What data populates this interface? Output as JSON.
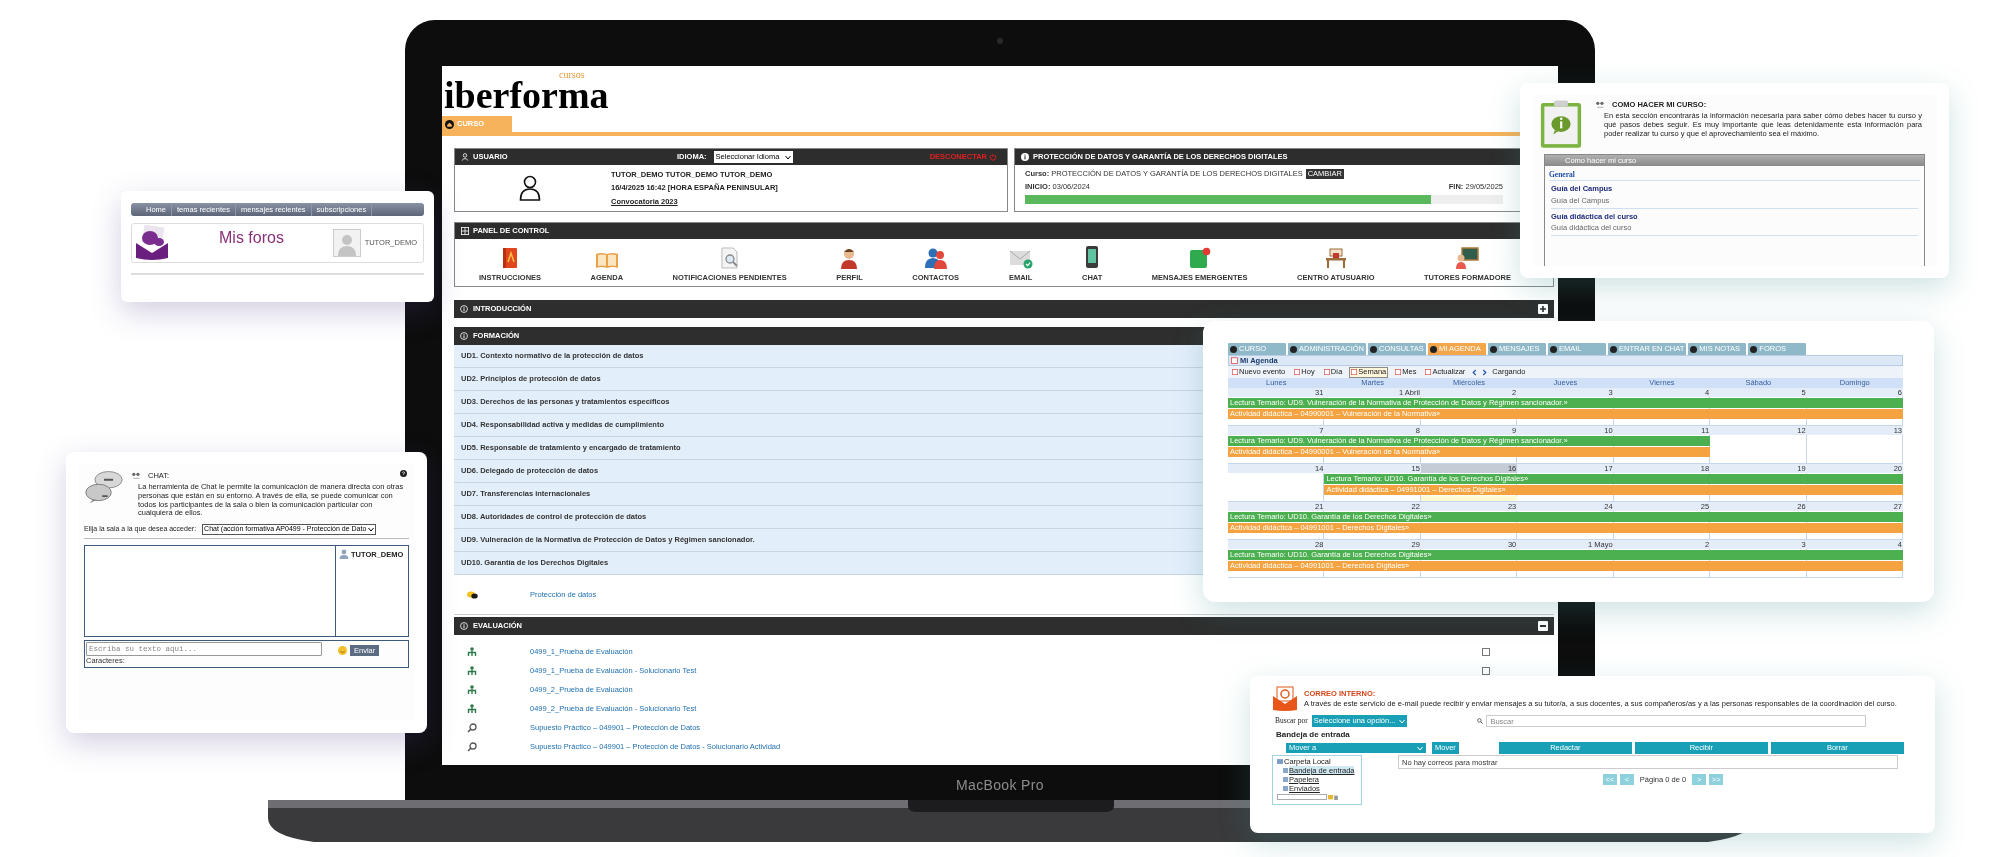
{
  "laptop": {
    "label": "MacBook Pro"
  },
  "screen": {
    "logo": {
      "small": "cursos",
      "main": "iberforma"
    },
    "tabs": [
      {
        "label": "CURSO",
        "selected": true
      }
    ],
    "user_panel": {
      "title": "USUARIO",
      "language_label": "IDIOMA:",
      "language_select": "Seleccionar Idioma",
      "logout": "DESCONECTAR",
      "name": "TUTOR_DEMO TUTOR_DEMO TUTOR_DEMO",
      "datetime": "16/4/2025 16:42 [HORA ESPAÑA PENINSULAR]",
      "link": "Convocatoria 2023"
    },
    "course_panel": {
      "title": "PROTECCIÓN DE DATOS Y GARANTÍA DE LOS DERECHOS DIGITALES",
      "course": "**Curso:** PROTECCIÓN DE DATOS Y GARANTÍA DE LOS DERECHOS DIGITALES",
      "change_button": "CAMBIAR",
      "start": "**INICIO:** 03/06/2024",
      "end": "**FIN:** 29/05/2025",
      "level": 0.85
    },
    "control_panel": {
      "title": "PANEL DE CONTROL",
      "items": [
        "INSTRUCCIONES",
        "AGENDA",
        "NOTIFICACIONES PENDIENTES",
        "PERFIL",
        "CONTACTOS",
        "EMAIL",
        "CHAT",
        "MENSAJES EMERGENTES",
        "CENTRO ATUSUARIO",
        "TUTORES FORMADORE"
      ]
    },
    "introduction": {
      "title": "INTRODUCCIÓN",
      "expanded": false
    },
    "formation": {
      "title": "FORMACIÓN",
      "units": [
        "UD1. Contexto normativo de la protección de datos",
        "UD2. Principios de protección de datos",
        "UD3. Derechos de las personas y tratamientos específicos",
        "UD4. Responsabilidad activa y medidas de cumplimiento",
        "UD5. Responsable de tratamiento y encargado de tratamiento",
        "UD6. Delegado de protección de datos",
        "UD7. Transferencias internacionales",
        "UD8. Autoridades de control de protección de datos",
        "UD9. Vulneración de la Normativa de Protección de Datos y Régimen sancionador.",
        "UD10. Garantía de los Derechos Digitales"
      ],
      "resource": "Protección de datos"
    },
    "evaluation": {
      "title": "EVALUACIÓN",
      "expanded": true,
      "items": [
        {
          "text": "0499_1_Prueba de Evaluación",
          "kind": "test",
          "checked": false
        },
        {
          "text": "0499_1_Prueba de Evaluación - Solucionario Test",
          "kind": "test",
          "checked": false
        },
        {
          "text": "0499_2_Prueba de Evaluación",
          "kind": "test"
        },
        {
          "text": "0499_2_Prueba de Evaluación - Solucionario Test",
          "kind": "test"
        },
        {
          "text": "Supuesto Práctico – 049901 – Protección de Datos",
          "kind": "case"
        },
        {
          "text": "Supuesto Práctico – 049901 – Protección de Datos - Solucionario Actividad",
          "kind": "case"
        }
      ]
    }
  },
  "forums_window": {
    "nav": [
      "Home",
      "temas recientes",
      "mensajes recientes",
      "subscripciones"
    ],
    "title": "Mis foros",
    "user": "TUTOR_DEMO"
  },
  "chat_window": {
    "heading": "CHAT:",
    "description": "La herramienta de Chat le permite la comunicación de manera directa con otras personas que están en su entorno. A través de ella, se puede comunicar con todos los participantes de la sala o bien la comunicación particular con cualquiera de ellos.",
    "room_label": "Elija la sala a la que desea acceder:",
    "room_select": "Chat (acción formativa AP0499 - Protección de Dato",
    "users": [
      "TUTOR_DEMO"
    ],
    "input": {
      "placeholder": "Escriba su texto aquí..."
    },
    "counter": "Caracteres:",
    "send": "Enviar"
  },
  "info_window": {
    "heading": "COMO HACER MI CURSO:",
    "description": "En esta sección encontrarás la información necesaria para saber cómo debes hacer tu curso y qué pasos debes seguir. Es muy importante que leas detenidamente esta información para poder realizar tu curso y que el aprovechamiento sea el máximo.",
    "box_title": "Como hacer mi curso",
    "group": "General",
    "entries": [
      {
        "title": "Guía del Campus",
        "subtitle": "Guía del Campus"
      },
      {
        "title": "Guía didáctica del curso",
        "subtitle": "Guía didáctica del curso"
      }
    ]
  },
  "calendar_window": {
    "tabs": [
      {
        "label": "CURSO",
        "selected": false
      },
      {
        "label": "ADMINISTRACIÓN",
        "selected": false
      },
      {
        "label": "CONSULTAS",
        "selected": false
      },
      {
        "label": "MI AGENDA",
        "selected": true
      },
      {
        "label": "MENSAJES",
        "selected": false
      },
      {
        "label": "EMAIL",
        "selected": false
      },
      {
        "label": "ENTRAR EN CHAT",
        "selected": false
      },
      {
        "label": "MIS NOTAS",
        "selected": false
      },
      {
        "label": "FOROS",
        "selected": false
      }
    ],
    "title": "Mi Agenda",
    "toolbar": [
      {
        "label": "Nuevo evento",
        "selected": false
      },
      {
        "label": "Hoy",
        "selected": false
      },
      {
        "label": "Día",
        "selected": false
      },
      {
        "label": "Semana",
        "selected": true
      },
      {
        "label": "Mes",
        "selected": false
      },
      {
        "label": "Actualizar",
        "selected": false
      }
    ],
    "status": "Cargando",
    "days": [
      "Lunes",
      "Martes",
      "Miércoles",
      "Jueves",
      "Viernes",
      "Sábado",
      "Domingo"
    ],
    "weeks": [
      {
        "dates": [
          {
            "label": "31",
            "today": false
          },
          {
            "label": "1 Abril",
            "today": false
          },
          {
            "label": "2",
            "today": false
          },
          {
            "label": "3",
            "today": false
          },
          {
            "label": "4",
            "today": false
          },
          {
            "label": "5",
            "today": false
          },
          {
            "label": "6",
            "today": false
          }
        ],
        "events": [
          {
            "text": "Lectura Temario: UD9. Vulneración de la Normativa de Protección de Datos y Régimen sancionador.»",
            "color": "#4caf50",
            "kind": "full"
          },
          {
            "text": "Actividad didáctica – 04990001 – Vulneración de la Normativa»",
            "color": "#f4a340",
            "kind": "full"
          }
        ]
      },
      {
        "dates": [
          {
            "label": "7",
            "today": false
          },
          {
            "label": "8",
            "today": false
          },
          {
            "label": "9",
            "today": false
          },
          {
            "label": "10",
            "today": false
          },
          {
            "label": "11",
            "today": false
          },
          {
            "label": "12",
            "today": false
          },
          {
            "label": "13",
            "today": false
          }
        ],
        "events": [
          {
            "text": "Lectura Temario: UD9. Vulneración de la Normativa de Protección de Datos y Régimen sancionador.»",
            "color": "#4caf50",
            "kind": "monfri"
          },
          {
            "text": "Actividad didáctica – 04990001 – Vulneración de la Normativa»",
            "color": "#f4a340",
            "kind": "monfri"
          }
        ]
      },
      {
        "dates": [
          {
            "label": "14",
            "today": false
          },
          {
            "label": "15",
            "today": false
          },
          {
            "label": "16",
            "today": true
          },
          {
            "label": "17",
            "today": false
          },
          {
            "label": "18",
            "today": false
          },
          {
            "label": "19",
            "today": false
          },
          {
            "label": "20",
            "today": false
          }
        ],
        "events": [
          {
            "text": "Lectura Temario: UD10. Garantía de los Derechos Digitales»",
            "color": "#4caf50",
            "kind": "tuesun"
          },
          {
            "text": "Actividad didáctica – 04991001 – Derechos Digitales»",
            "color": "#f4a340",
            "kind": "tuesun"
          }
        ]
      },
      {
        "dates": [
          {
            "label": "21",
            "today": false
          },
          {
            "label": "22",
            "today": false
          },
          {
            "label": "23",
            "today": false
          },
          {
            "label": "24",
            "today": false
          },
          {
            "label": "25",
            "today": false
          },
          {
            "label": "26",
            "today": false
          },
          {
            "label": "27",
            "today": false
          }
        ],
        "events": [
          {
            "text": "Lectura Temario: UD10. Garantía de los Derechos Digitales»",
            "color": "#4caf50",
            "kind": "full"
          },
          {
            "text": "Actividad didáctica – 04991001 – Derechos Digitales»",
            "color": "#f4a340",
            "kind": "full"
          }
        ]
      },
      {
        "dates": [
          {
            "label": "28",
            "today": false
          },
          {
            "label": "29",
            "today": false
          },
          {
            "label": "30",
            "today": false
          },
          {
            "label": "1 Mayo",
            "today": false
          },
          {
            "label": "2",
            "today": false
          },
          {
            "label": "3",
            "today": false
          },
          {
            "label": "4",
            "today": false
          }
        ],
        "events": [
          {
            "text": "Lectura Temario: UD10. Garantía de los Derechos Digitales»",
            "color": "#4caf50",
            "kind": "full"
          },
          {
            "text": "Actividad didáctica – 04991001 – Derechos Digitales»",
            "color": "#f4a340",
            "kind": "full"
          }
        ]
      }
    ]
  },
  "mail_window": {
    "heading": "CORREO INTERNO:",
    "description": "A través de este servicio de e-mail puede recibir y enviar mensajes a su tutor/a, a sus docentes, a sus compañeros/as y a las personas responsables de la coordinación del curso.",
    "search_by": "Buscar por",
    "search_select": "Seleccione una opción...",
    "search": {
      "placeholder": "Buscar"
    },
    "folder_title": "Bandeja de entrada",
    "move_select": "Mover a",
    "buttons": [
      "Mover",
      "Redactar",
      "Recibir",
      "Borrar"
    ],
    "tree": {
      "label": "Carpeta Local",
      "selected": false,
      "children": [
        {
          "label": "Bandeja de entrada",
          "selected": true
        },
        {
          "label": "Papelera",
          "selected": false
        },
        {
          "label": "Enviados",
          "selected": false
        }
      ]
    },
    "empty": "No hay correos para mostrar",
    "pager": {
      "first": "<<",
      "prev": "<",
      "status": "Página 0 de 0",
      "next": ">",
      "last": ">>"
    }
  }
}
